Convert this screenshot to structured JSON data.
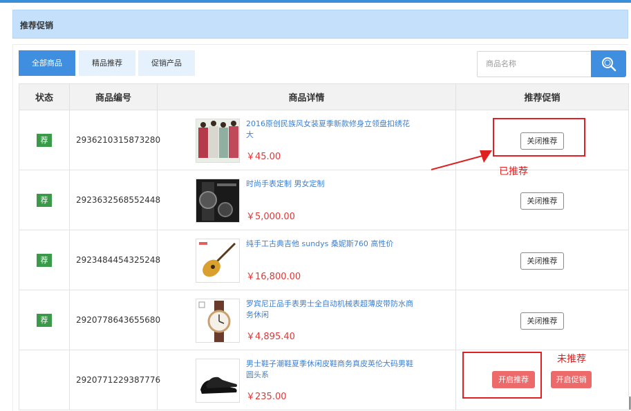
{
  "header": {
    "title": "推荐促销"
  },
  "tabs": [
    {
      "label": "全部商品"
    },
    {
      "label": "精品推荐"
    },
    {
      "label": "促销产品"
    }
  ],
  "search": {
    "placeholder": "商品名称"
  },
  "table": {
    "columns": [
      "状态",
      "商品编号",
      "商品详情",
      "推荐促销"
    ],
    "rows": [
      {
        "badge": "荐",
        "code": "2936210315873280",
        "name": "2016原创民族风女装夏季新款修身立领盘扣绣花 大",
        "price": "￥45.00",
        "action": "关闭推荐"
      },
      {
        "badge": "荐",
        "code": "2923632568552448",
        "name": "时尚手表定制 男女定制",
        "price": "￥5,000.00",
        "action": "关闭推荐"
      },
      {
        "badge": "荐",
        "code": "2923484454325248",
        "name": "纯手工古典吉他 sundys 桑妮斯760 高性价",
        "price": "￥16,800.00",
        "action": "关闭推荐"
      },
      {
        "badge": "荐",
        "code": "2920778643655680",
        "name": "罗宾尼正品手表男士全自动机械表超薄皮带防水商务休闲",
        "price": "￥4,895.40",
        "action": "关闭推荐"
      },
      {
        "badge": "",
        "code": "2920771229387776",
        "name": "男士鞋子潮鞋夏季休闲皮鞋商务真皮英伦大码男鞋圆头系",
        "price": "￥235.00",
        "action": "开启推荐",
        "action2": "开启促销"
      }
    ]
  },
  "annotations": {
    "recommended_label": "已推荐",
    "not_recommended_label": "未推荐"
  },
  "colors": {
    "accent": "#3f8ee0",
    "badge": "#3a9a49",
    "price": "#e53535",
    "annotation": "#e02020"
  }
}
